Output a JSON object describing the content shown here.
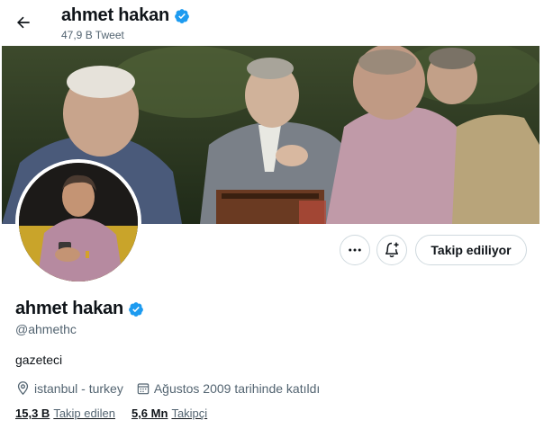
{
  "header": {
    "name": "ahmet hakan",
    "tweet_count": "47,9 B Tweet"
  },
  "profile": {
    "name": "ahmet hakan",
    "handle": "@ahmethc",
    "bio": "gazeteci",
    "location": "istanbul - turkey",
    "joined": "Ağustos 2009 tarihinde katıldı"
  },
  "actions": {
    "follow_label": "Takip ediliyor"
  },
  "stats": {
    "following_count": "15,3 B",
    "following_label": "Takip edilen",
    "followers_count": "5,6 Mn",
    "followers_label": "Takipçi"
  },
  "icons": {
    "back": "arrow-left-icon",
    "verified": "verified-badge-icon",
    "more": "more-horizontal-icon",
    "notify": "bell-plus-icon",
    "location": "location-pin-icon",
    "calendar": "calendar-icon"
  },
  "colors": {
    "verified_blue": "#1d9bf0",
    "text_primary": "#0f1419",
    "text_secondary": "#536471",
    "border": "#cfd9de"
  }
}
